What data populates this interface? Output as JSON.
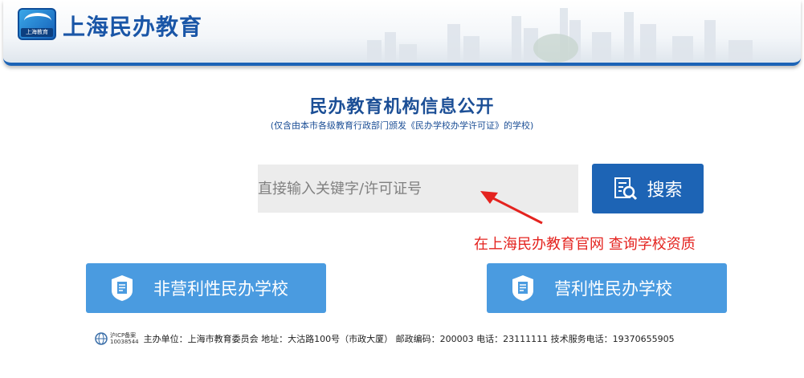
{
  "header": {
    "site_name": "上海民办教育",
    "logo_text": "上海教育"
  },
  "main": {
    "title": "民办教育机构信息公开",
    "subtitle": "(仅含由本市各级教育行政部门颁发《民办学校办学许可证》的学校)"
  },
  "search": {
    "placeholder": "直接输入关键字/许可证号",
    "value": "",
    "button_label": "搜索"
  },
  "annotation": {
    "text": "在上海民办教育官网 查询学校资质",
    "color": "#e4231f"
  },
  "categories": [
    {
      "label": "非营利性民办学校"
    },
    {
      "label": "营利性民办学校"
    }
  ],
  "footer": {
    "icp_label": "沪ICP备案",
    "icp_number": "10038544",
    "text": "主办单位：上海市教育委员会 地址：大沽路100号（市政大厦）   邮政编码：200003 电话：23111111 技术服务电话：19370655905"
  },
  "colors": {
    "primary_blue": "#1d64b5",
    "category_blue": "#4a9be0",
    "title_blue": "#1c4f96"
  }
}
